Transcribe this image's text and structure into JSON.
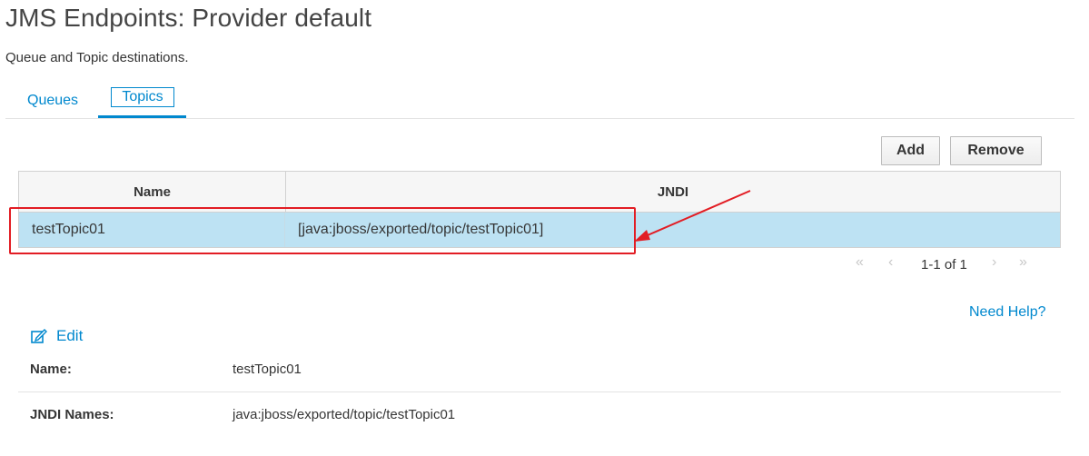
{
  "header": {
    "title": "JMS Endpoints: Provider default",
    "subtitle": "Queue and Topic destinations."
  },
  "tabs": [
    {
      "label": "Queues",
      "active": false
    },
    {
      "label": "Topics",
      "active": true
    }
  ],
  "toolbar": {
    "add_label": "Add",
    "remove_label": "Remove"
  },
  "table": {
    "columns": [
      "Name",
      "JNDI"
    ],
    "rows": [
      {
        "name": "testTopic01",
        "jndi": "[java:jboss/exported/topic/testTopic01]",
        "selected": true
      }
    ]
  },
  "pager": {
    "first_icon": "double-chevron-left-icon",
    "prev_icon": "chevron-left-icon",
    "range_text": "1-1 of 1",
    "next_icon": "chevron-right-icon",
    "last_icon": "double-chevron-right-icon"
  },
  "help_link": "Need Help?",
  "details": {
    "edit_label": "Edit",
    "edit_icon": "pencil-square-icon",
    "fields": [
      {
        "label": "Name:",
        "value": "testTopic01"
      },
      {
        "label": "JNDI Names:",
        "value": "java:jboss/exported/topic/testTopic01"
      }
    ]
  },
  "annotation": {
    "color": "#e21d24"
  },
  "colors": {
    "accent": "#0088ce",
    "selected_row": "#bde2f3"
  }
}
